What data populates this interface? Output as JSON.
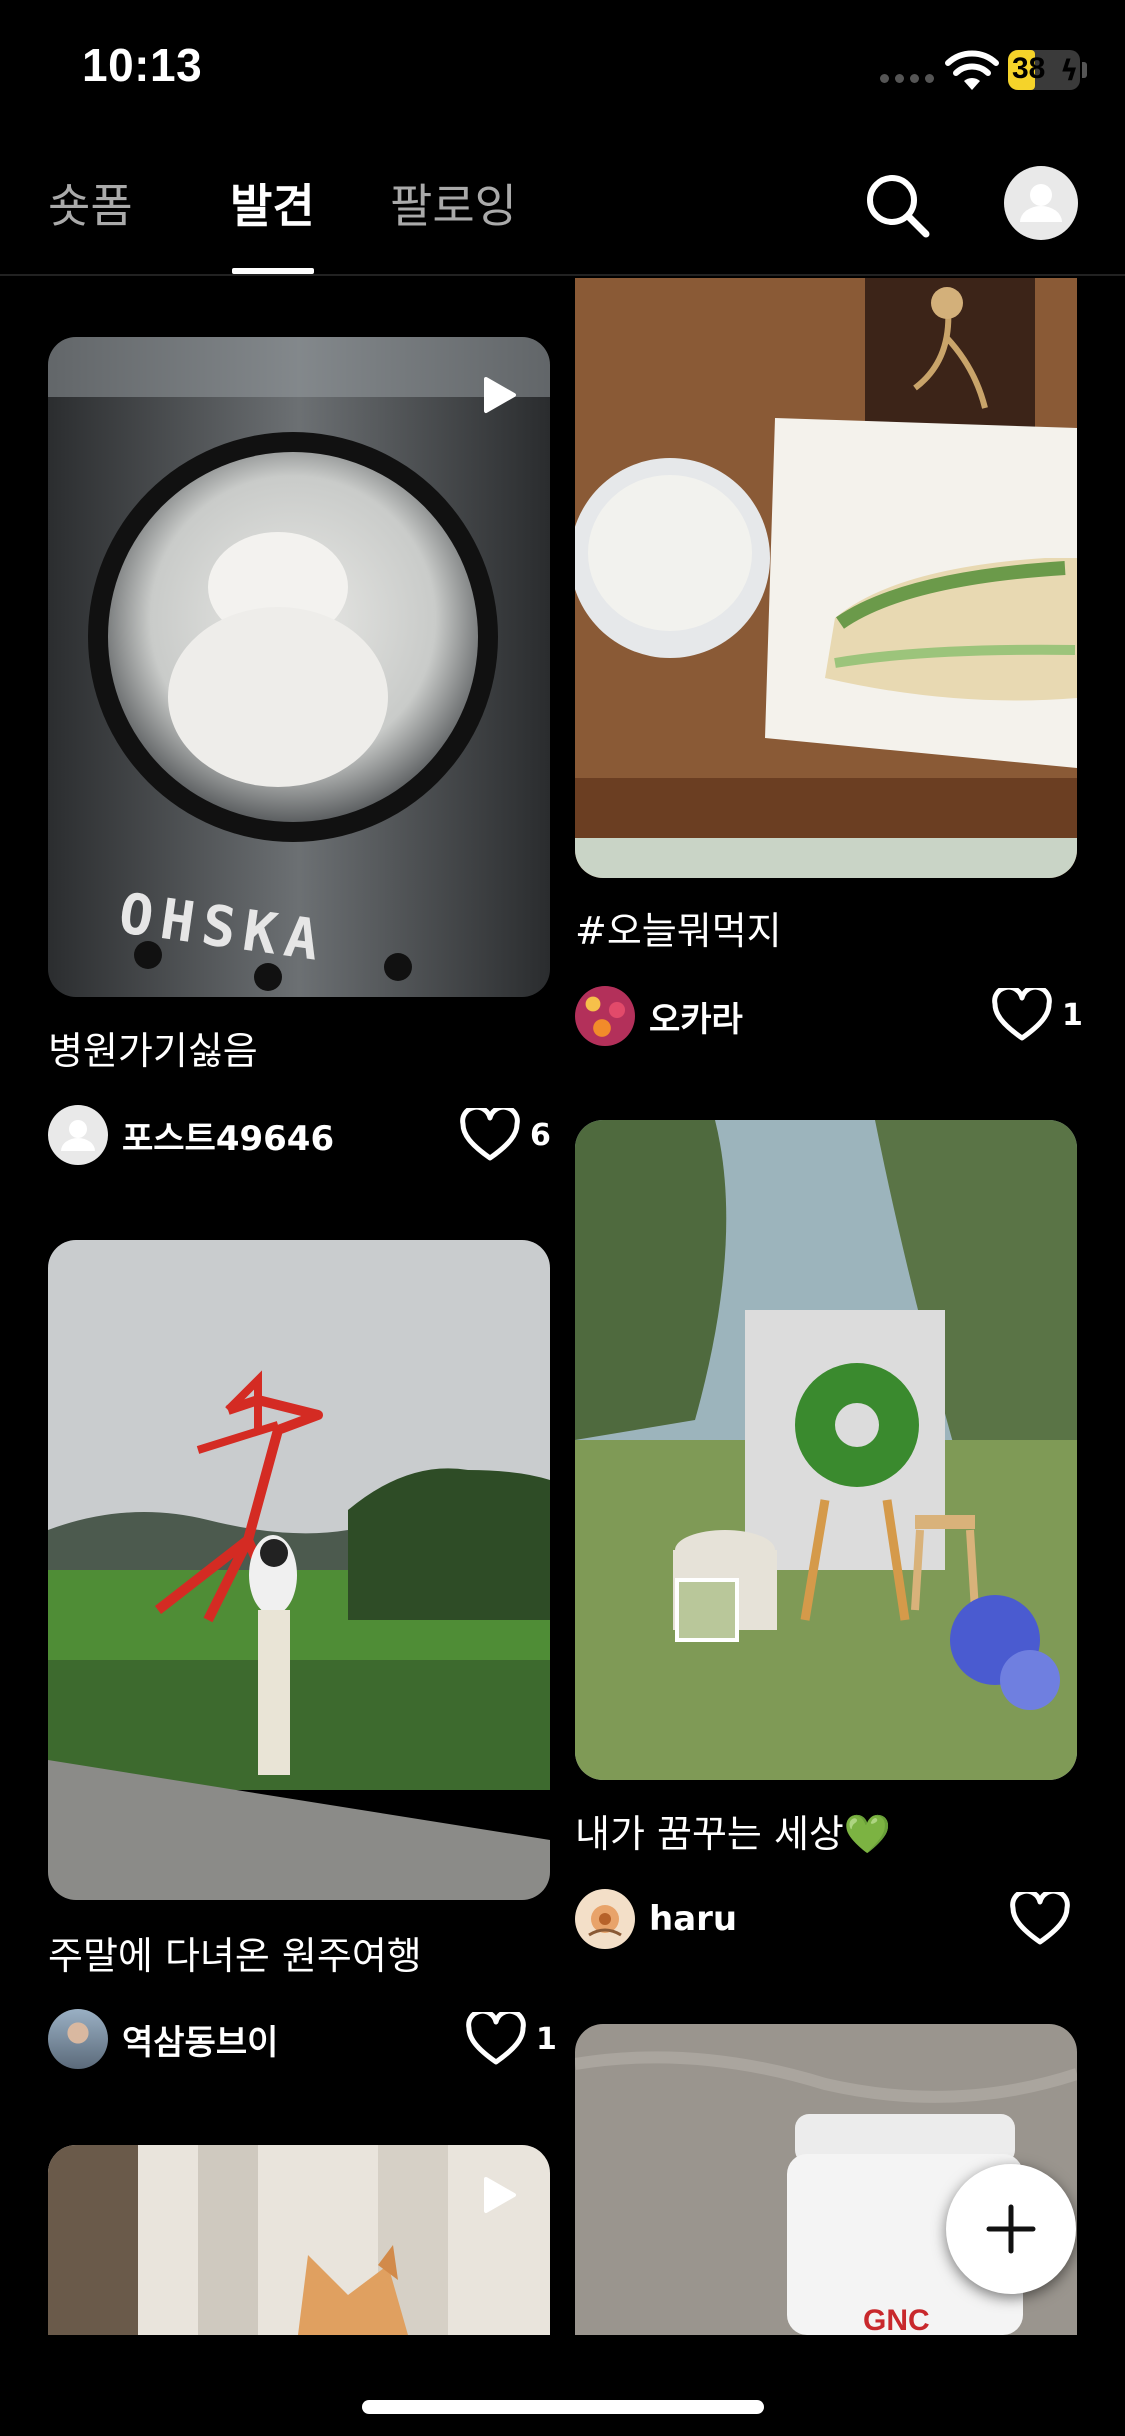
{
  "status_bar": {
    "time": "10:13",
    "battery_level": "38",
    "battery_fraction": 0.38,
    "battery_color": "#f5d32a"
  },
  "header": {
    "tabs": [
      {
        "label": "숏폼",
        "active": false
      },
      {
        "label": "발견",
        "active": true
      },
      {
        "label": "팔로잉",
        "active": false
      }
    ],
    "icons": [
      "search-icon",
      "profile-icon"
    ]
  },
  "feed": {
    "posts": [
      {
        "caption": "병원가기싫음",
        "author": "포스트49646",
        "likes": "6",
        "is_video": true,
        "image": "cat in astronaut backpack"
      },
      {
        "caption": "#오늘뭐먹지",
        "author": "오카라",
        "likes": "1",
        "is_video": false,
        "image": "sandwich and milk"
      },
      {
        "caption": "주말에 다녀온 원주여행",
        "author": "역삼동브이",
        "likes": "1",
        "is_video": false,
        "image": "red sculpture on lawn"
      },
      {
        "caption": "내가 꿈꾸는 세상💚",
        "author": "haru",
        "likes": "",
        "is_video": false,
        "image": "garden with wreath"
      },
      {
        "caption": "",
        "author": "",
        "likes": "",
        "is_video": true,
        "image": "cat by window"
      },
      {
        "caption": "",
        "author": "",
        "likes": "",
        "is_video": false,
        "image": "supplement bottle",
        "bottle_label": "GNC"
      }
    ]
  },
  "fab": {
    "icon": "plus-icon"
  }
}
